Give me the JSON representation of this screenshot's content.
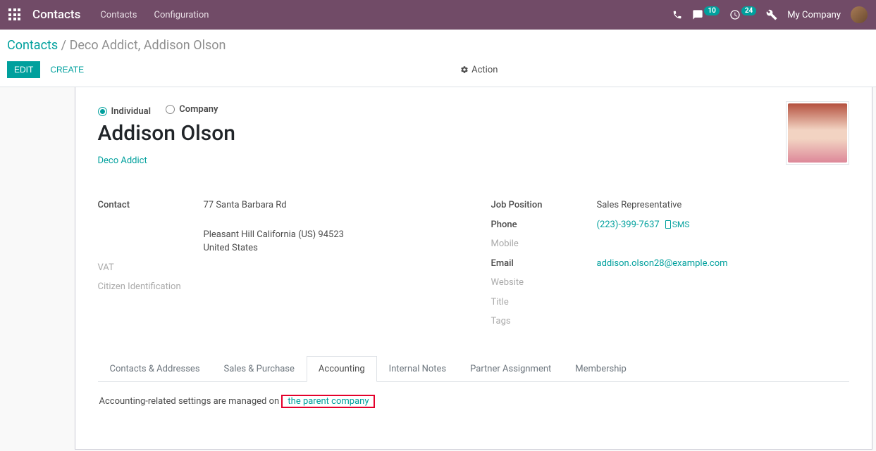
{
  "navbar": {
    "brand": "Contacts",
    "links": [
      "Contacts",
      "Configuration"
    ],
    "msg_count": "10",
    "activity_count": "24",
    "company": "My Company"
  },
  "breadcrumb": {
    "root": "Contacts",
    "sep": " / ",
    "current": "Deco Addict, Addison Olson"
  },
  "actions": {
    "edit": "Edit",
    "create": "Create",
    "action": "Action"
  },
  "record": {
    "type_individual_label": "Individual",
    "type_company_label": "Company",
    "name": "Addison Olson",
    "company_link": "Deco Addict"
  },
  "left_fields": {
    "contact_label": "Contact",
    "street": "77 Santa Barbara Rd",
    "city_line": "Pleasant Hill  California (US)  94523",
    "country": "United States",
    "vat_label": "VAT",
    "citizen_label": "Citizen Identification"
  },
  "right_fields": {
    "job_label": "Job Position",
    "job_value": "Sales Representative",
    "phone_label": "Phone",
    "phone_value": "(223)-399-7637",
    "sms_label": "SMS",
    "mobile_label": "Mobile",
    "email_label": "Email",
    "email_value": "addison.olson28@example.com",
    "website_label": "Website",
    "title_label": "Title",
    "tags_label": "Tags"
  },
  "tabs": {
    "items": [
      "Contacts & Addresses",
      "Sales & Purchase",
      "Accounting",
      "Internal Notes",
      "Partner Assignment",
      "Membership"
    ],
    "accounting_msg_prefix": "Accounting-related settings are managed on ",
    "accounting_link": "the parent company"
  }
}
